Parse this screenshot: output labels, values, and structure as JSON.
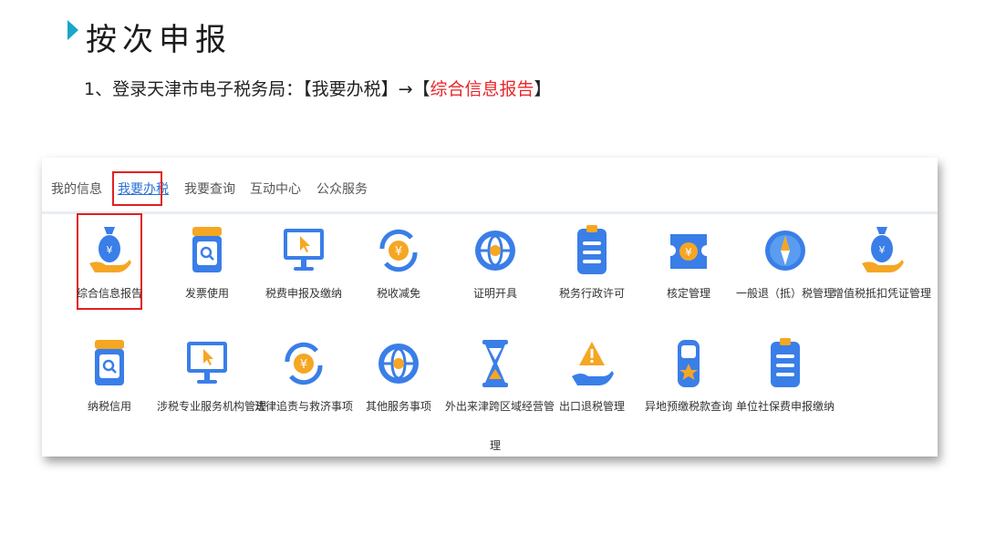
{
  "slide": {
    "title": "按次申报",
    "step_prefix": "1、登录天津市电子税务局：【我要办税】→【",
    "step_highlight": "综合信息报告",
    "step_suffix": "】"
  },
  "tabs": [
    {
      "label": "我的信息",
      "active": false
    },
    {
      "label": "我要办税",
      "active": true
    },
    {
      "label": "我要查询",
      "active": false
    },
    {
      "label": "互动中心",
      "active": false
    },
    {
      "label": "公众服务",
      "active": false
    }
  ],
  "row1": [
    {
      "label": "综合信息报告",
      "icon": "money-bag-hand-icon"
    },
    {
      "label": "发票使用",
      "icon": "search-document-icon"
    },
    {
      "label": "税费申报及缴纳",
      "icon": "monitor-cursor-icon"
    },
    {
      "label": "税收减免",
      "icon": "yuan-refresh-icon"
    },
    {
      "label": "证明开具",
      "icon": "globe-icon"
    },
    {
      "label": "税务行政许可",
      "icon": "clipboard-list-icon"
    },
    {
      "label": "核定管理",
      "icon": "yuan-ticket-icon"
    },
    {
      "label": "一般退（抵）税管理",
      "icon": "compass-icon"
    },
    {
      "label": "增值税抵扣凭证管理",
      "icon": "money-bag-hand-icon"
    }
  ],
  "row2": [
    {
      "label": "纳税信用",
      "icon": "search-document-icon"
    },
    {
      "label": "涉税专业服务机构管理",
      "icon": "monitor-cursor-icon"
    },
    {
      "label": "法律追责与救济事项",
      "icon": "yuan-refresh-icon"
    },
    {
      "label": "其他服务事项",
      "icon": "globe-icon"
    },
    {
      "label": "外出来津跨区域经营管",
      "icon": "hourglass-icon"
    },
    {
      "label": "出口退税管理",
      "icon": "warning-hand-icon"
    },
    {
      "label": "异地预缴税款查询",
      "icon": "star-card-icon"
    },
    {
      "label": "单位社保费申报缴纳",
      "icon": "clipboard-list-icon"
    }
  ],
  "row2_wrap_tail": "理",
  "colors": {
    "accent_blue": "#2b6fd6",
    "icon_blue": "#3a7ee8",
    "icon_orange": "#f5a623",
    "highlight_red": "#e8262a",
    "title_marker": "#1aa6c9"
  }
}
